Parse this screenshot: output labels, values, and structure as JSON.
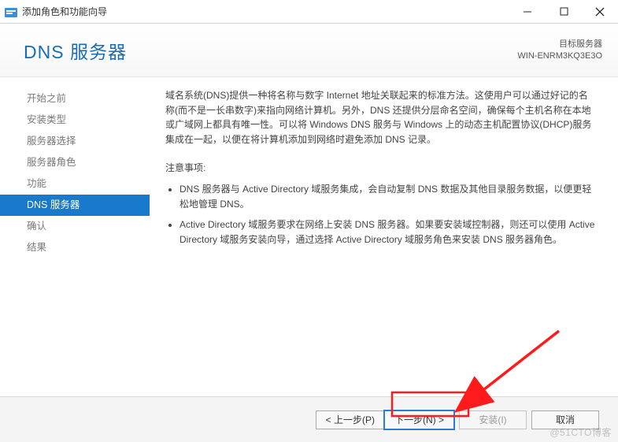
{
  "window": {
    "title": "添加角色和功能向导"
  },
  "header": {
    "heading": "DNS 服务器",
    "dest_label": "目标服务器",
    "dest_value": "WIN-ENRM3KQ3E3O"
  },
  "sidebar": {
    "steps": [
      "开始之前",
      "安装类型",
      "服务器选择",
      "服务器角色",
      "功能",
      "DNS 服务器",
      "确认",
      "结果"
    ],
    "active_index": 5
  },
  "content": {
    "description": "域名系统(DNS)提供一种将名称与数字 Internet 地址关联起来的标准方法。这使用户可以通过好记的名称(而不是一长串数字)来指向网络计算机。另外，DNS 还提供分层命名空间，确保每个主机名称在本地或广域网上都具有唯一性。可以将 Windows DNS 服务与 Windows 上的动态主机配置协议(DHCP)服务集成在一起，以便在将计算机添加到网络时避免添加 DNS 记录。",
    "note_heading": "注意事项:",
    "bullets": [
      "DNS 服务器与 Active Directory 域服务集成，会自动复制 DNS 数据及其他目录服务数据，以便更轻松地管理 DNS。",
      "Active Directory 域服务要求在网络上安装 DNS 服务器。如果要安装域控制器，则还可以使用 Active Directory 域服务安装向导，通过选择 Active Directory 域服务角色来安装 DNS 服务器角色。"
    ]
  },
  "footer": {
    "prev": "< 上一步(P)",
    "next": "下一步(N) >",
    "install": "安装(I)",
    "cancel": "取消"
  },
  "watermark": "@51CTO博客"
}
